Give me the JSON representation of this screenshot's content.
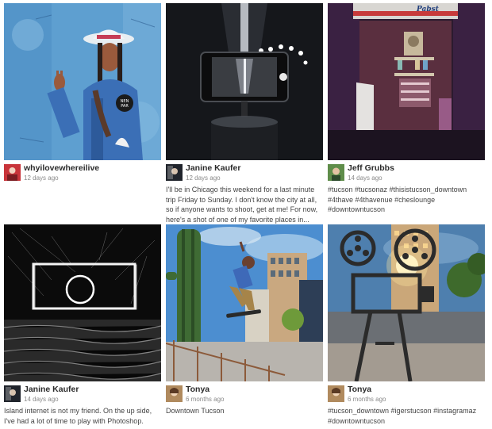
{
  "posts": [
    {
      "user": "whyilovewhereilive",
      "time": "12 days ago",
      "caption": "",
      "avatar_color": "#c8343a"
    },
    {
      "user": "Janine Kaufer",
      "time": "12 days ago",
      "caption": "I'll be in Chicago this weekend for a last minute trip Friday to Sunday. I don't know the city at all, so if anyone wants to shoot, get at me! For now, here's a shot of one of my favorite places in...",
      "avatar_color": "#20242c"
    },
    {
      "user": "Jeff Grubbs",
      "time": "14 days ago",
      "caption": "#tucson #tucsonaz #thisistucson_downtown #4thave #4thavenue #cheslounge #downtowntucson",
      "avatar_color": "#5f8d4a"
    },
    {
      "user": "Janine Kaufer",
      "time": "14 days ago",
      "caption": "Island internet is not my friend. On the up side, I've had a lot of time to play with Photoshop.",
      "avatar_color": "#20242c"
    },
    {
      "user": "Tonya",
      "time": "6 months ago",
      "caption": "Downtown Tucson",
      "avatar_color": "#b08a5e"
    },
    {
      "user": "Tonya",
      "time": "6 months ago",
      "caption": "#tucson_downtown #igerstucson #instagramaz #downtowntucson",
      "avatar_color": "#b08a5e"
    }
  ],
  "mural_badge": "NEN PAR",
  "sign_text": "Pabst"
}
